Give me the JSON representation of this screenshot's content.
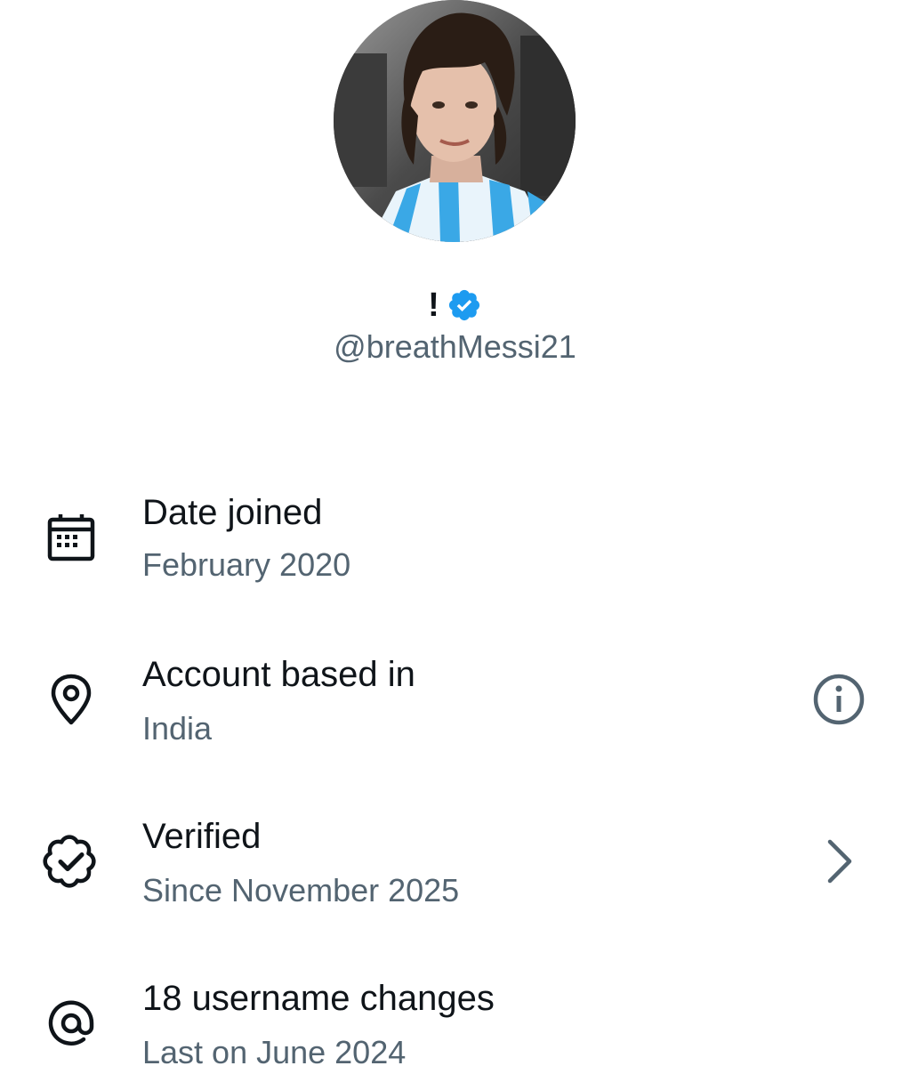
{
  "profile": {
    "display_name": "!",
    "handle": "@breathMessi21",
    "avatar_icon": "profile-photo",
    "verified_badge_icon": "verified-badge-icon",
    "verified_badge_color": "#1d9bf0"
  },
  "about": {
    "items": [
      {
        "title": "Date joined",
        "subtitle": "February 2020",
        "icon": "calendar-icon"
      },
      {
        "title": "Account based in",
        "subtitle": "India",
        "icon": "location-pin-icon",
        "trailing_icon": "info-icon"
      },
      {
        "title": "Verified",
        "subtitle": "Since November 2025",
        "icon": "verified-outline-icon",
        "trailing_icon": "chevron-right-icon"
      },
      {
        "title": "18 username changes",
        "subtitle": "Last on June 2024",
        "icon": "at-sign-icon"
      }
    ]
  },
  "colors": {
    "primary_text": "#0f1419",
    "secondary_text": "#536471",
    "accent": "#1d9bf0"
  }
}
